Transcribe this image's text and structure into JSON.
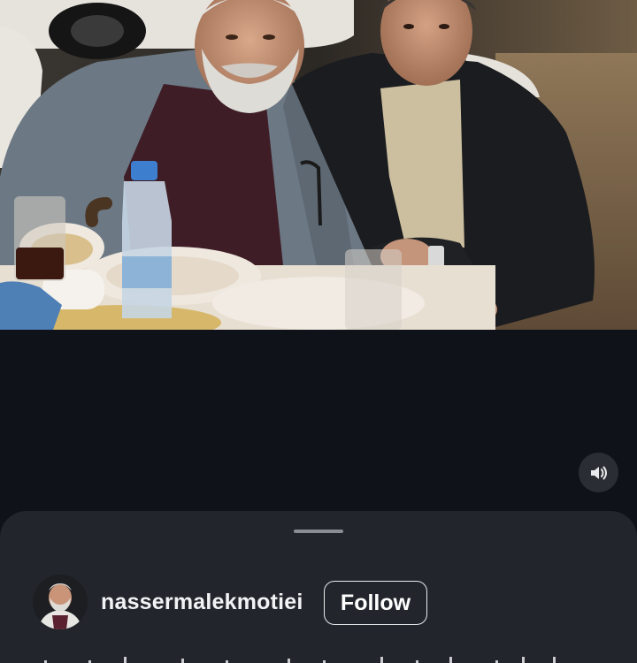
{
  "post": {
    "author": {
      "username": "nassermalekmotiei",
      "avatar_icon": "profile-photo"
    },
    "follow_label": "Follow",
    "sound_icon": "speaker-icon"
  },
  "colors": {
    "background": "#0f1218",
    "sheet": "#22262c",
    "sound_button": "#2a2d33",
    "text": "#f2f3f5"
  }
}
